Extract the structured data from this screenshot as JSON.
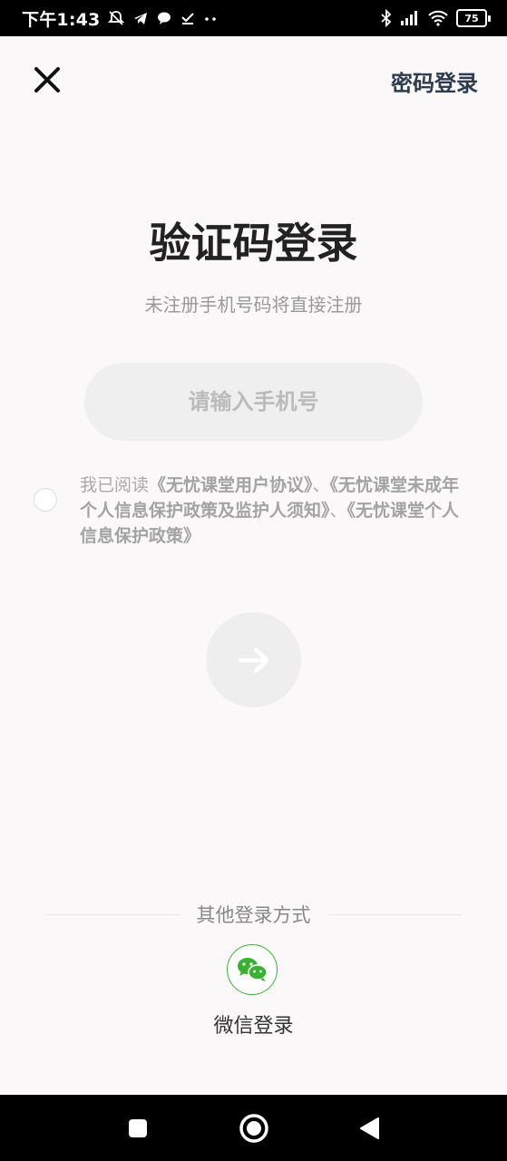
{
  "status_bar": {
    "time": "下午1:43",
    "battery_level": "75",
    "icons": [
      "mute-bell-icon",
      "telegram-icon",
      "chat-bubble-icon",
      "download-check-icon",
      "more-dots-icon",
      "bluetooth-icon",
      "signal-icon",
      "wifi-icon",
      "battery-icon"
    ]
  },
  "header": {
    "close_icon": "close-icon",
    "password_login_label": "密码登录"
  },
  "main": {
    "title": "验证码登录",
    "subtitle": "未注册手机号码将直接注册",
    "phone_input": {
      "placeholder": "请输入手机号",
      "value": ""
    },
    "agreement": {
      "prefix": "我已阅读",
      "link1": "《无忧课堂用户协议》",
      "sep1": "、",
      "link2": "《无忧课堂未成年个人信息保护政策及监护人须知》",
      "sep2": "、",
      "link3": "《无忧课堂个人信息保护政策》",
      "checked": false
    },
    "next_button_icon": "arrow-right-icon"
  },
  "other_login": {
    "divider_label": "其他登录方式",
    "wechat_label": "微信登录",
    "wechat_color": "#3cb034"
  },
  "nav_bar": {
    "icons": [
      "recents-square-icon",
      "home-circle-icon",
      "back-triangle-icon"
    ]
  }
}
